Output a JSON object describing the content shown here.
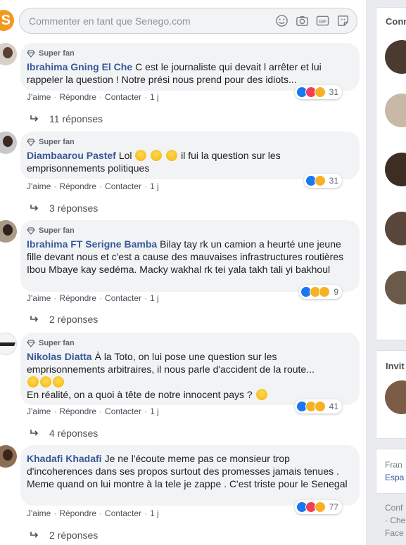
{
  "composer": {
    "placeholder": "Commenter en tant que Senego.com",
    "icons": [
      "smiley-icon",
      "camera-icon",
      "gif-icon",
      "sticker-icon"
    ]
  },
  "comments": [
    {
      "badge": "Super fan",
      "author": "Ibrahima Gning El Che",
      "text": "C est le journaliste qui devait l arrêter et lui rappeler la question ! Notre prési nous prend pour des idiots...",
      "reactions": [
        "like",
        "love",
        "haha"
      ],
      "reaction_count": "31",
      "actions": {
        "like": "J'aime",
        "reply": "Répondre",
        "contact": "Contacter",
        "time": "1 j"
      },
      "replies": "11 réponses"
    },
    {
      "badge": "Super fan",
      "author": "Diambaarou Pastef",
      "text_before": "Lol",
      "text_after": "il fui la question sur les emprisonnements politiques",
      "reactions": [
        "like",
        "haha"
      ],
      "reaction_count": "31",
      "actions": {
        "like": "J'aime",
        "reply": "Répondre",
        "contact": "Contacter",
        "time": "1 j"
      },
      "replies": "3 réponses"
    },
    {
      "badge": "Super fan",
      "author": "Ibrahima FT Serigne Bamba",
      "text": "Bilay tay rk un camion a heurté une jeune fille devant nous et c'est a cause des mauvaises infrastructures routières Ibou Mbaye kay sedéma. Macky wakhal rk tei yala takh tali yi bakhoul",
      "reactions": [
        "like",
        "sad",
        "haha"
      ],
      "reaction_count": "9",
      "actions": {
        "like": "J'aime",
        "reply": "Répondre",
        "contact": "Contacter",
        "time": "1 j"
      },
      "replies": "2 réponses"
    },
    {
      "badge": "Super fan",
      "author": "Nikolas Diatta",
      "text": "À la Toto, on lui pose une question sur les emprisonnements arbitraires, il nous parle d'accident de la route...",
      "text_line2": "En réalité, on a quoi à tête de notre innocent pays ?",
      "reactions": [
        "like",
        "haha",
        "sad"
      ],
      "reaction_count": "41",
      "actions": {
        "like": "J'aime",
        "reply": "Répondre",
        "contact": "Contacter",
        "time": "1 j"
      },
      "replies": "4 réponses"
    },
    {
      "author": "Khadafi Khadafi",
      "text": "Je ne l'écoute meme pas ce monsieur trop d'incoherences dans ses propos surtout des promesses jamais tenues . Meme quand on lui montre à la tele je zappe . C'est triste pour le Senegal",
      "reactions": [
        "like",
        "love",
        "haha"
      ],
      "reaction_count": "77",
      "actions": {
        "like": "J'aime",
        "reply": "Répondre",
        "contact": "Contacter",
        "time": "1 j"
      },
      "replies": "2 réponses"
    }
  ],
  "sidebar": {
    "card1_title": "Conn",
    "card2_title": "Invit",
    "link_fran": "Fran",
    "link_esp": "Espa",
    "link_conf": "Conf",
    "link_che": "· Che",
    "link_face": "Face"
  },
  "colors": {
    "author": "#385898",
    "bubble": "#f2f3f5",
    "like": "#1877f2",
    "love": "#f33e58",
    "haha": "#f7b125",
    "brand": "#f29a1e"
  }
}
